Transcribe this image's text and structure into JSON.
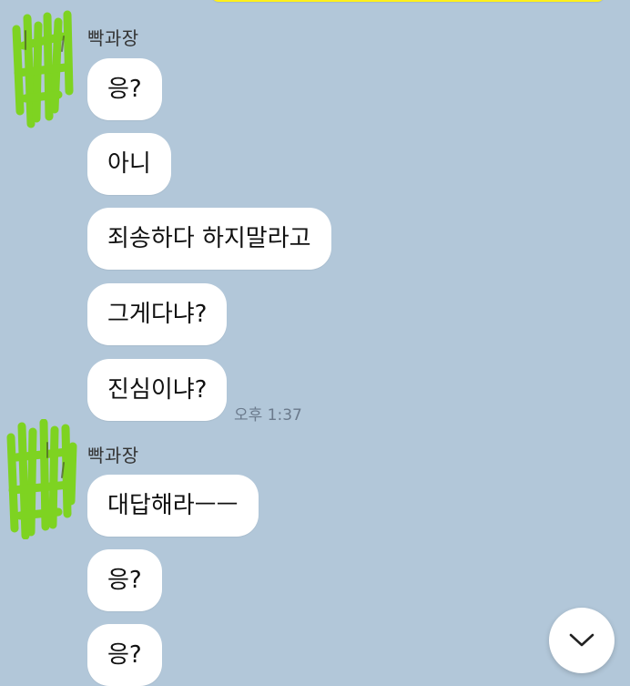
{
  "chat": {
    "colors": {
      "background": "#b2c7d9",
      "bubble": "#ffffff",
      "top_bubble": "#fef01b",
      "avatar_scribble": "#7ed321"
    },
    "groups": [
      {
        "sender": "빡과장",
        "avatar_icon": "green-scribble-avatar-icon",
        "messages": [
          "응?",
          "아니",
          "죄송하다 하지말라고",
          "그게다냐?",
          "진심이냐?"
        ],
        "time": "오후 1:37"
      },
      {
        "sender": "빡과장",
        "avatar_icon": "green-scribble-avatar-icon",
        "messages": [
          "대답해라ㅡㅡ",
          "응?",
          "응?"
        ]
      }
    ],
    "scroll_button_icon": "chevron-down-icon"
  }
}
